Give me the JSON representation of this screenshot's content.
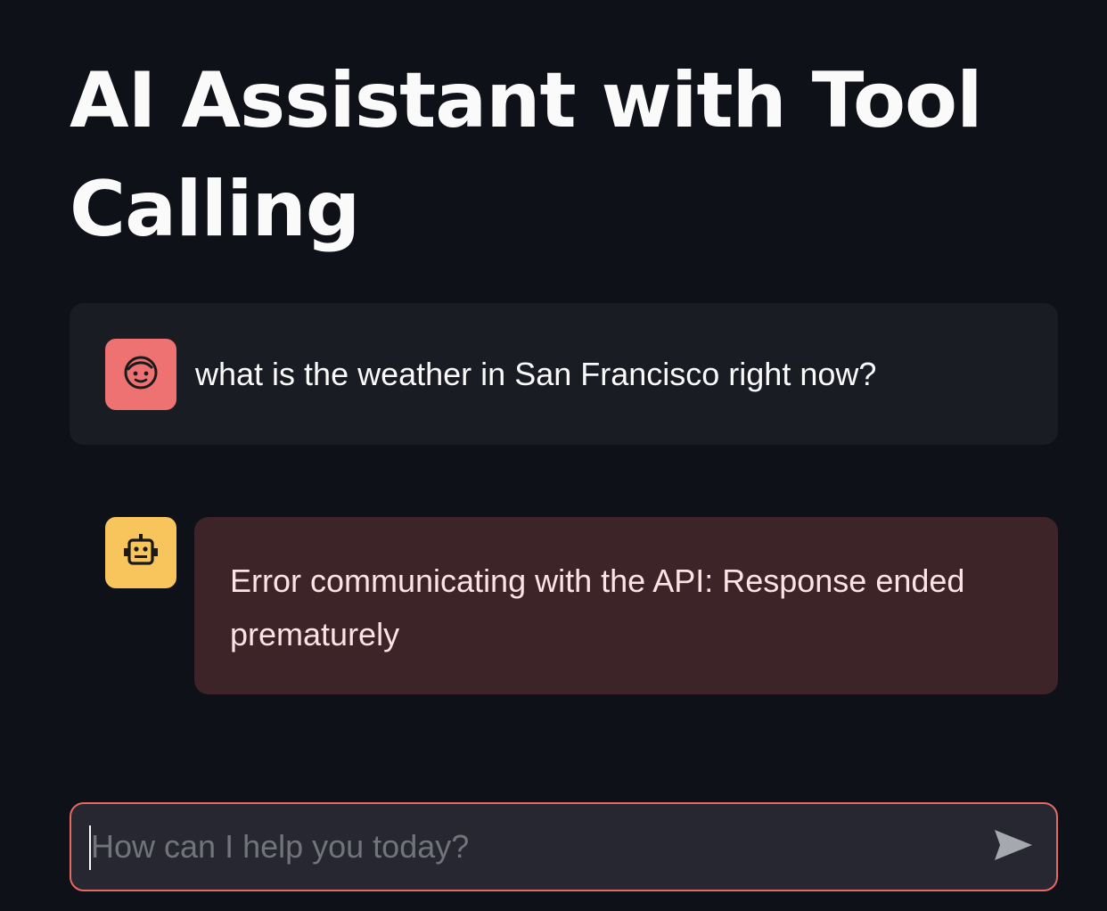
{
  "page": {
    "title": "AI Assistant with Tool Calling"
  },
  "messages": [
    {
      "role": "user",
      "avatar_icon": "face-icon",
      "avatar_color": "#ee7272",
      "text": "what is the weather in San Francisco right now?"
    },
    {
      "role": "assistant",
      "avatar_icon": "robot-icon",
      "avatar_color": "#f7c55c",
      "text": "Error communicating with the API: Response ended prematurely",
      "status": "error"
    }
  ],
  "chat_input": {
    "value": "",
    "placeholder": "How can I help you today?",
    "send_icon": "send-icon"
  },
  "colors": {
    "background": "#0e1117",
    "user_message_bg": "#1a1c24",
    "error_message_bg": "#3d2429",
    "input_border": "#e66a62"
  }
}
